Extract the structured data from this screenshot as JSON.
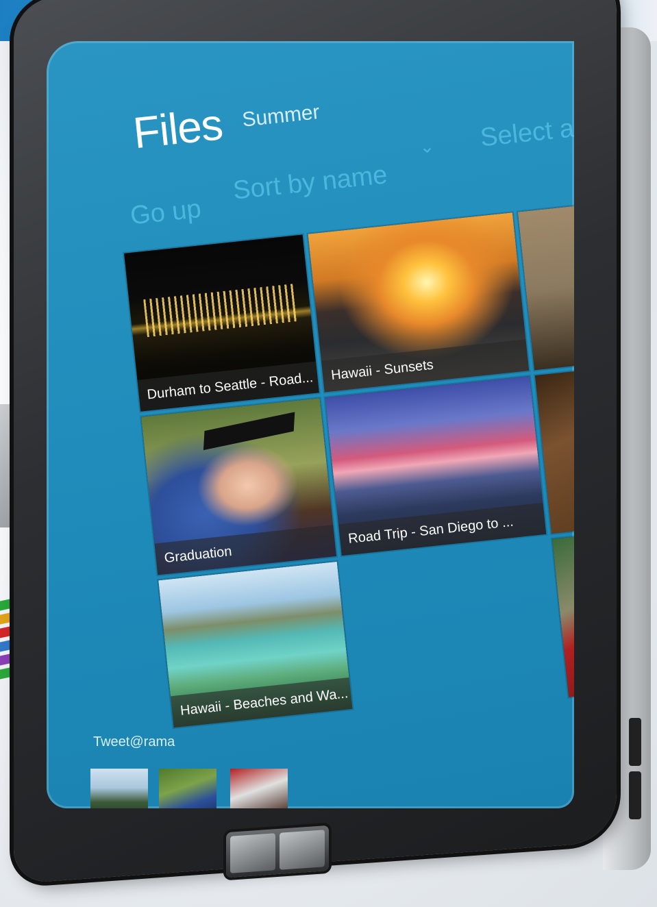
{
  "header": {
    "title": "Files",
    "subtitle": "Summer"
  },
  "commands": {
    "go_up": "Go up",
    "sort": "Sort by name",
    "sort_chevron": "⌄",
    "select_all": "Select all"
  },
  "tiles": [
    {
      "caption": "Durham to Seattle - Road..."
    },
    {
      "caption": "Hawaii - Sunsets"
    },
    {
      "caption": "Graduation"
    },
    {
      "caption": "Road Trip - San Diego to ..."
    },
    {
      "caption": "Hawaii - Beaches and Wa..."
    }
  ],
  "tweet": {
    "label": "Tweet@rama"
  },
  "colors": {
    "screen": "#1f8cbb",
    "command_text": "#59c3e8",
    "title_text": "#ffffff"
  }
}
